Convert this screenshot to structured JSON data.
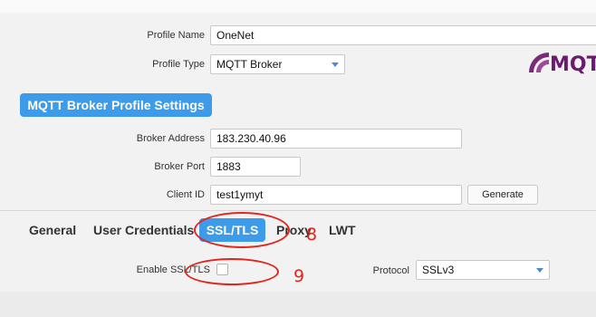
{
  "profile": {
    "name_label": "Profile Name",
    "name_value": "OneNet",
    "type_label": "Profile Type",
    "type_value": "MQTT Broker"
  },
  "logo": {
    "text": "MQTT",
    "color": "#6a1b6e"
  },
  "section": {
    "header": "MQTT Broker Profile Settings"
  },
  "broker": {
    "address_label": "Broker Address",
    "address_value": "183.230.40.96",
    "port_label": "Broker Port",
    "port_value": "1883",
    "client_id_label": "Client ID",
    "client_id_value": "test1ymyt",
    "generate_label": "Generate"
  },
  "tabs": [
    {
      "label": "General",
      "active": false
    },
    {
      "label": "User Credentials",
      "active": false
    },
    {
      "label": "SSL/TLS",
      "active": true
    },
    {
      "label": "Proxy",
      "active": false
    },
    {
      "label": "LWT",
      "active": false
    }
  ],
  "ssl": {
    "enable_label": "Enable SSL/TLS",
    "enable_checked": false,
    "protocol_label": "Protocol",
    "protocol_value": "SSLv3"
  },
  "annotations": {
    "a8": "8",
    "a9": "9",
    "color": "#e0261f"
  },
  "colors": {
    "accent": "#3d9be9",
    "background": "#f2f2f2"
  }
}
